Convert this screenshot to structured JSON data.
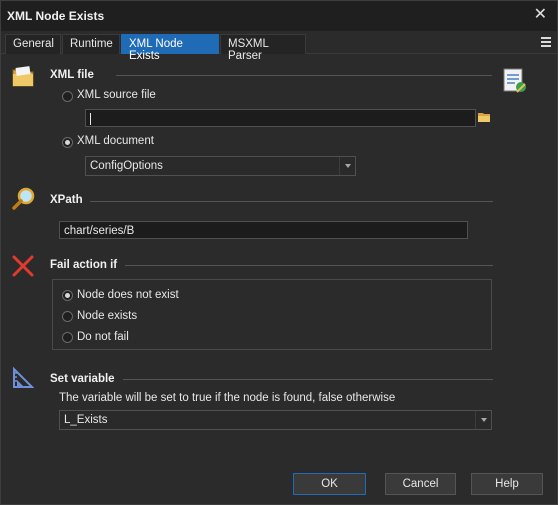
{
  "window": {
    "title": "XML Node Exists",
    "close_glyph": "✕"
  },
  "tabs": [
    {
      "label": "General"
    },
    {
      "label": "Runtime"
    },
    {
      "label": "XML Node Exists",
      "active": true
    },
    {
      "label": "MSXML Parser"
    }
  ],
  "xml_file": {
    "title": "XML file",
    "source_file_label": "XML source file",
    "source_file_value": "",
    "document_label": "XML document",
    "document_selected": "ConfigOptions",
    "selected_option": "XML document"
  },
  "xpath": {
    "title": "XPath",
    "value": "chart/series/B"
  },
  "fail_action": {
    "title": "Fail action if",
    "options": [
      "Node does not exist",
      "Node exists",
      "Do not fail"
    ],
    "selected": "Node does not exist"
  },
  "set_variable": {
    "title": "Set variable",
    "description": "The variable will be set to true if the node is found, false otherwise",
    "selected": "L_Exists"
  },
  "buttons": {
    "ok": "OK",
    "cancel": "Cancel",
    "help": "Help"
  },
  "icons": {
    "xml_file": "folder-icon",
    "xpath": "magnifier-icon",
    "fail_action": "red-x-icon",
    "set_variable": "ruler-icon",
    "browse": "folder-small-icon",
    "document": "xml-document-icon"
  },
  "colors": {
    "accent": "#1f6bb5",
    "background": "#2b2b2b",
    "title_bar": "#1f1f1f"
  }
}
